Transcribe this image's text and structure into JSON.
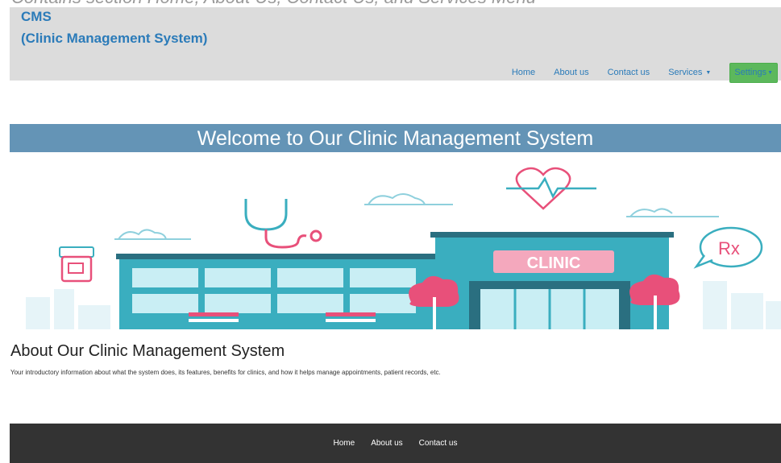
{
  "top_strip_text": "Contains section Home, About Us, Contact Us, and Services Menu",
  "brand": {
    "line1": "CMS",
    "line2": "(Clinic Management System)"
  },
  "nav": {
    "home": "Home",
    "about": "About us",
    "contact": "Contact us",
    "services": "Services",
    "settings": "Settings"
  },
  "welcome": "Welcome to Our Clinic Management System",
  "banner": {
    "clinic_sign": "CLINIC",
    "rx": "Rx"
  },
  "about": {
    "title": "About Our Clinic Management System",
    "text": "Your introductory information about what the system does, its features, benefits for clinics, and how it helps manage appointments, patient records, etc."
  },
  "footer": {
    "home": "Home",
    "about": "About us",
    "contact": "Contact us"
  },
  "colors": {
    "brand": "#2b7bb9",
    "header_bg": "#dcdcdc",
    "welcome_bg": "#6494b6",
    "settings_bg": "#5cb85c",
    "footer_bg": "#333333",
    "teal": "#3aaebf",
    "pink": "#e8507a"
  }
}
